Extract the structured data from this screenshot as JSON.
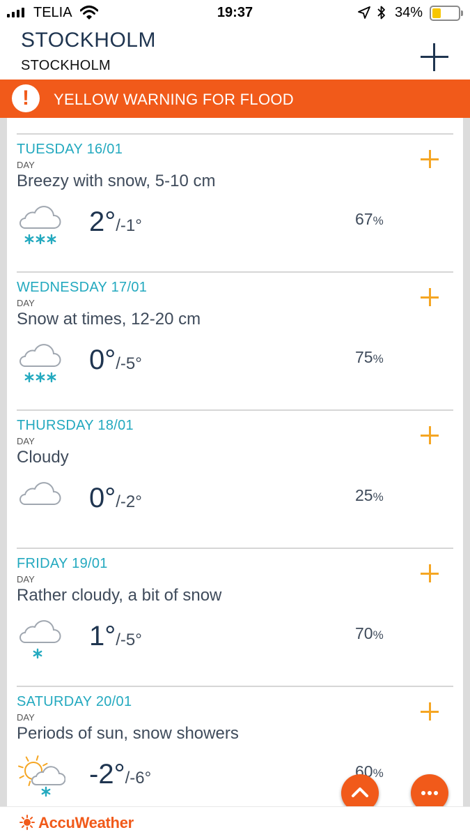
{
  "status_bar": {
    "carrier": "TELIA",
    "time": "19:37",
    "battery": "34%",
    "battery_level": 0.34
  },
  "header": {
    "city": "STOCKHOLM",
    "region": "STOCKHOLM",
    "add_icon": "plus-icon"
  },
  "warning": {
    "icon": "exclamation-icon",
    "text": "YELLOW WARNING FOR FLOOD",
    "color": "#f15a1a"
  },
  "forecast": [
    {
      "date": "TUESDAY 16/01",
      "period": "DAY",
      "phrase": "Breezy with snow, 5-10 cm",
      "icon": "cloud-snow-icon",
      "high": "2°",
      "low": "/-1°",
      "precip_value": "67",
      "precip_unit": "%"
    },
    {
      "date": "WEDNESDAY 17/01",
      "period": "DAY",
      "phrase": "Snow at times, 12-20 cm",
      "icon": "cloud-snow-icon",
      "high": "0°",
      "low": "/-5°",
      "precip_value": "75",
      "precip_unit": "%"
    },
    {
      "date": "THURSDAY 18/01",
      "period": "DAY",
      "phrase": "Cloudy",
      "icon": "cloud-icon",
      "high": "0°",
      "low": "/-2°",
      "precip_value": "25",
      "precip_unit": "%"
    },
    {
      "date": "FRIDAY 19/01",
      "period": "DAY",
      "phrase": "Rather cloudy, a bit of snow",
      "icon": "cloud-light-snow-icon",
      "high": "1°",
      "low": "/-5°",
      "precip_value": "70",
      "precip_unit": "%"
    },
    {
      "date": "SATURDAY 20/01",
      "period": "DAY",
      "phrase": "Periods of sun, snow showers",
      "icon": "sun-cloud-snow-icon",
      "high": "-2°",
      "low": "/-6°",
      "precip_value": "60",
      "precip_unit": "%"
    }
  ],
  "footer": {
    "brand": "AccuWeather",
    "brand_color": "#f15a1a"
  },
  "colors": {
    "accent_blue": "#23a9bf",
    "plus_orange": "#f5a623",
    "navy": "#1f3550"
  }
}
